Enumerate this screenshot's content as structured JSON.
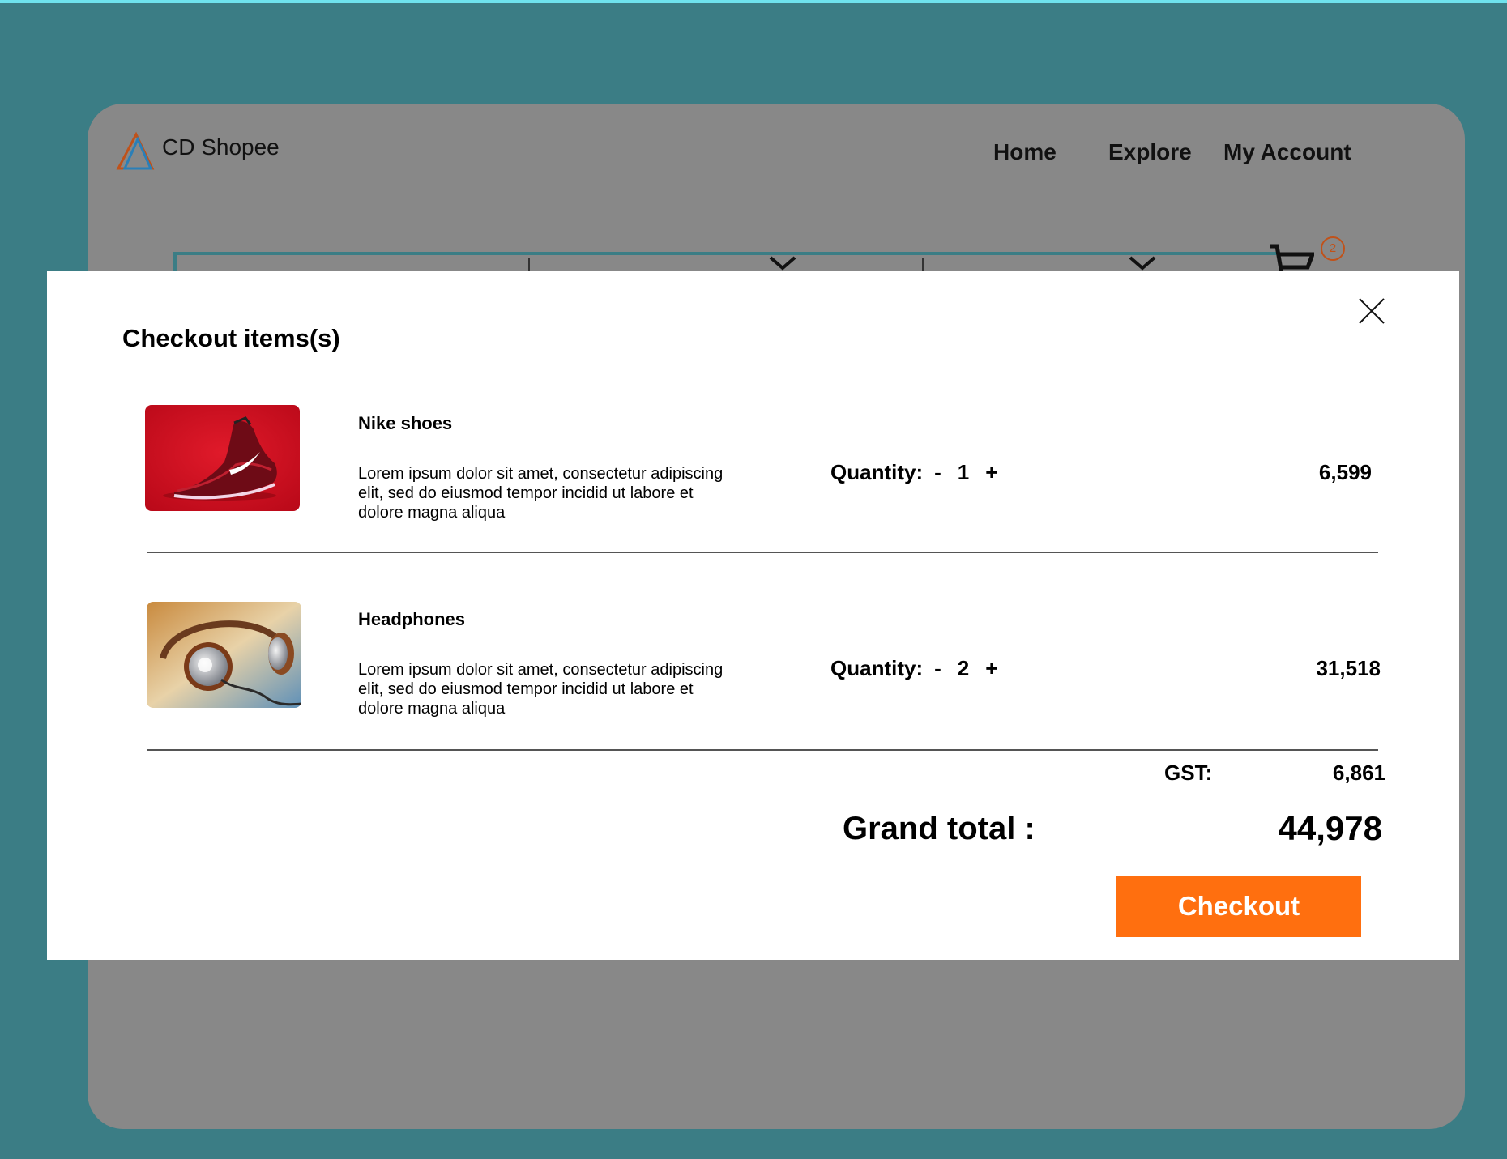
{
  "header": {
    "brand": "CD Shopee",
    "nav": {
      "home": "Home",
      "explore": "Explore",
      "account": "My Account"
    },
    "cart_count": "2"
  },
  "modal": {
    "title": "Checkout items(s)",
    "items": [
      {
        "name": "Nike shoes",
        "description": "Lorem ipsum dolor sit amet, consectetur adipiscing elit, sed do eiusmod tempor incidid ut labore et dolore magna aliqua",
        "quantity_label": "Quantity:",
        "minus": "-",
        "quantity": "1",
        "plus": "+",
        "price": "6,599",
        "image": "red-shoe-image"
      },
      {
        "name": "Headphones",
        "description": "Lorem ipsum dolor sit amet, consectetur adipiscing elit, sed do eiusmod tempor incidid ut labore et dolore magna aliqua",
        "quantity_label": "Quantity:",
        "minus": "-",
        "quantity": "2",
        "plus": "+",
        "price": "31,518",
        "image": "headphones-image"
      }
    ],
    "gst_label": "GST:",
    "gst_value": "6,861",
    "grand_total_label": "Grand total :",
    "grand_total_value": "44,978",
    "checkout_label": "Checkout"
  },
  "colors": {
    "background": "#3b7d85",
    "app_dimmed": "#888888",
    "checkout_button": "#ff6f0f",
    "badge": "#c0521a"
  },
  "icons": [
    "logo-icon",
    "chevron-down-icon",
    "cart-icon",
    "close-icon"
  ]
}
